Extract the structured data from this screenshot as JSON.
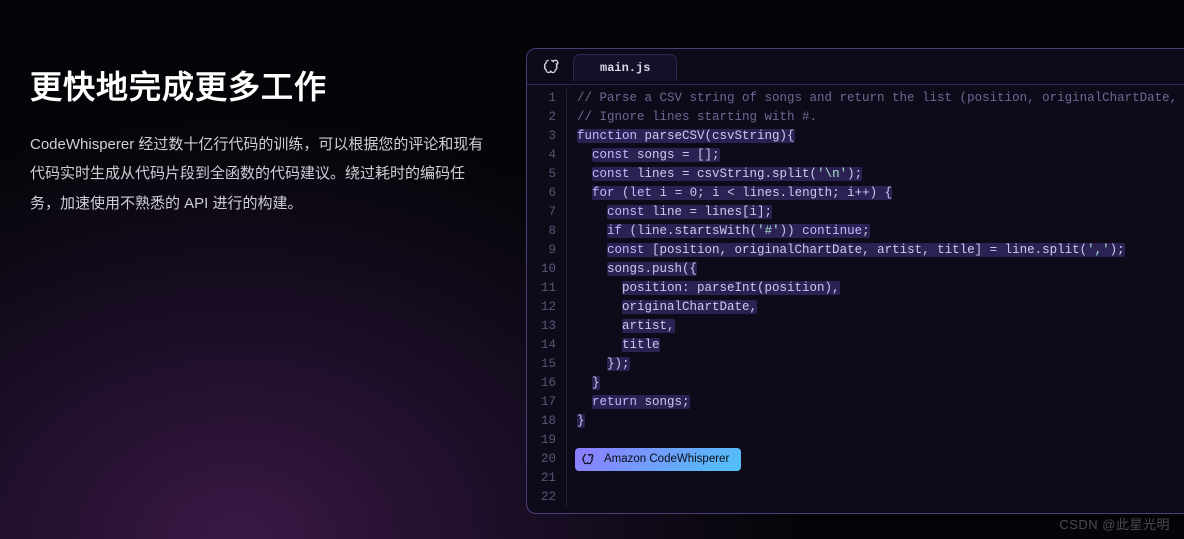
{
  "left": {
    "heading": "更快地完成更多工作",
    "desc": "CodeWhisperer 经过数十亿行代码的训练，可以根据您的评论和现有代码实时生成从代码片段到全函数的代码建议。绕过耗时的编码任务，加速使用不熟悉的 API 进行的构建。"
  },
  "editor": {
    "tab": "main.js",
    "badge": "Amazon CodeWhisperer",
    "line_numbers": [
      "1",
      "2",
      "3",
      "4",
      "5",
      "6",
      "7",
      "8",
      "9",
      "10",
      "11",
      "12",
      "13",
      "14",
      "15",
      "16",
      "17",
      "18",
      "19",
      "20",
      "21",
      "22"
    ],
    "lines": [
      {
        "type": "comment",
        "text": "// Parse a CSV string of songs and return the list (position, originalChartDate, artist, title)."
      },
      {
        "type": "comment",
        "text": "// Ignore lines starting with #."
      },
      {
        "type": "hl",
        "segments": [
          {
            "c": "kw",
            "t": "function"
          },
          {
            "c": "",
            "t": " parseCSV(csvString){"
          }
        ]
      },
      {
        "type": "hl",
        "indent": 2,
        "segments": [
          {
            "c": "kw",
            "t": "const"
          },
          {
            "c": "",
            "t": " songs = [];"
          }
        ]
      },
      {
        "type": "hl",
        "indent": 2,
        "segments": [
          {
            "c": "kw",
            "t": "const"
          },
          {
            "c": "",
            "t": " lines = csvString.split("
          },
          {
            "c": "str",
            "t": "'\\n'"
          },
          {
            "c": "",
            "t": ");"
          }
        ]
      },
      {
        "type": "hl",
        "indent": 2,
        "segments": [
          {
            "c": "kw",
            "t": "for"
          },
          {
            "c": "",
            "t": " ("
          },
          {
            "c": "kw",
            "t": "let"
          },
          {
            "c": "",
            "t": " i = 0; i < lines.length; i++) {"
          }
        ]
      },
      {
        "type": "hl",
        "indent": 4,
        "segments": [
          {
            "c": "kw",
            "t": "const"
          },
          {
            "c": "",
            "t": " line = lines[i];"
          }
        ]
      },
      {
        "type": "hl",
        "indent": 4,
        "segments": [
          {
            "c": "kw",
            "t": "if"
          },
          {
            "c": "",
            "t": " (line.startsWith("
          },
          {
            "c": "str",
            "t": "'#'"
          },
          {
            "c": "",
            "t": ")) "
          },
          {
            "c": "kw",
            "t": "continue"
          },
          {
            "c": "",
            "t": ";"
          }
        ]
      },
      {
        "type": "hl",
        "indent": 4,
        "segments": [
          {
            "c": "kw",
            "t": "const"
          },
          {
            "c": "",
            "t": " [position, originalChartDate, artist, title] = line.split("
          },
          {
            "c": "str",
            "t": "','"
          },
          {
            "c": "",
            "t": ");"
          }
        ]
      },
      {
        "type": "hl",
        "indent": 4,
        "segments": [
          {
            "c": "",
            "t": "songs.push({"
          }
        ]
      },
      {
        "type": "hl",
        "indent": 6,
        "segments": [
          {
            "c": "",
            "t": "position: parseInt(position),"
          }
        ]
      },
      {
        "type": "hl",
        "indent": 6,
        "segments": [
          {
            "c": "",
            "t": "originalChartDate,"
          }
        ]
      },
      {
        "type": "hl",
        "indent": 6,
        "segments": [
          {
            "c": "",
            "t": "artist,"
          }
        ]
      },
      {
        "type": "hl",
        "indent": 6,
        "segments": [
          {
            "c": "",
            "t": "title"
          }
        ]
      },
      {
        "type": "hl",
        "indent": 4,
        "segments": [
          {
            "c": "",
            "t": "});"
          }
        ]
      },
      {
        "type": "hl",
        "indent": 2,
        "segments": [
          {
            "c": "",
            "t": "}"
          }
        ]
      },
      {
        "type": "hl",
        "indent": 2,
        "segments": [
          {
            "c": "kw",
            "t": "return"
          },
          {
            "c": "",
            "t": " songs;"
          }
        ]
      },
      {
        "type": "hl",
        "segments": [
          {
            "c": "",
            "t": "}"
          }
        ]
      },
      {
        "type": "blank"
      },
      {
        "type": "badge"
      },
      {
        "type": "blank"
      },
      {
        "type": "blank"
      }
    ]
  },
  "watermark": "CSDN @此星光明"
}
